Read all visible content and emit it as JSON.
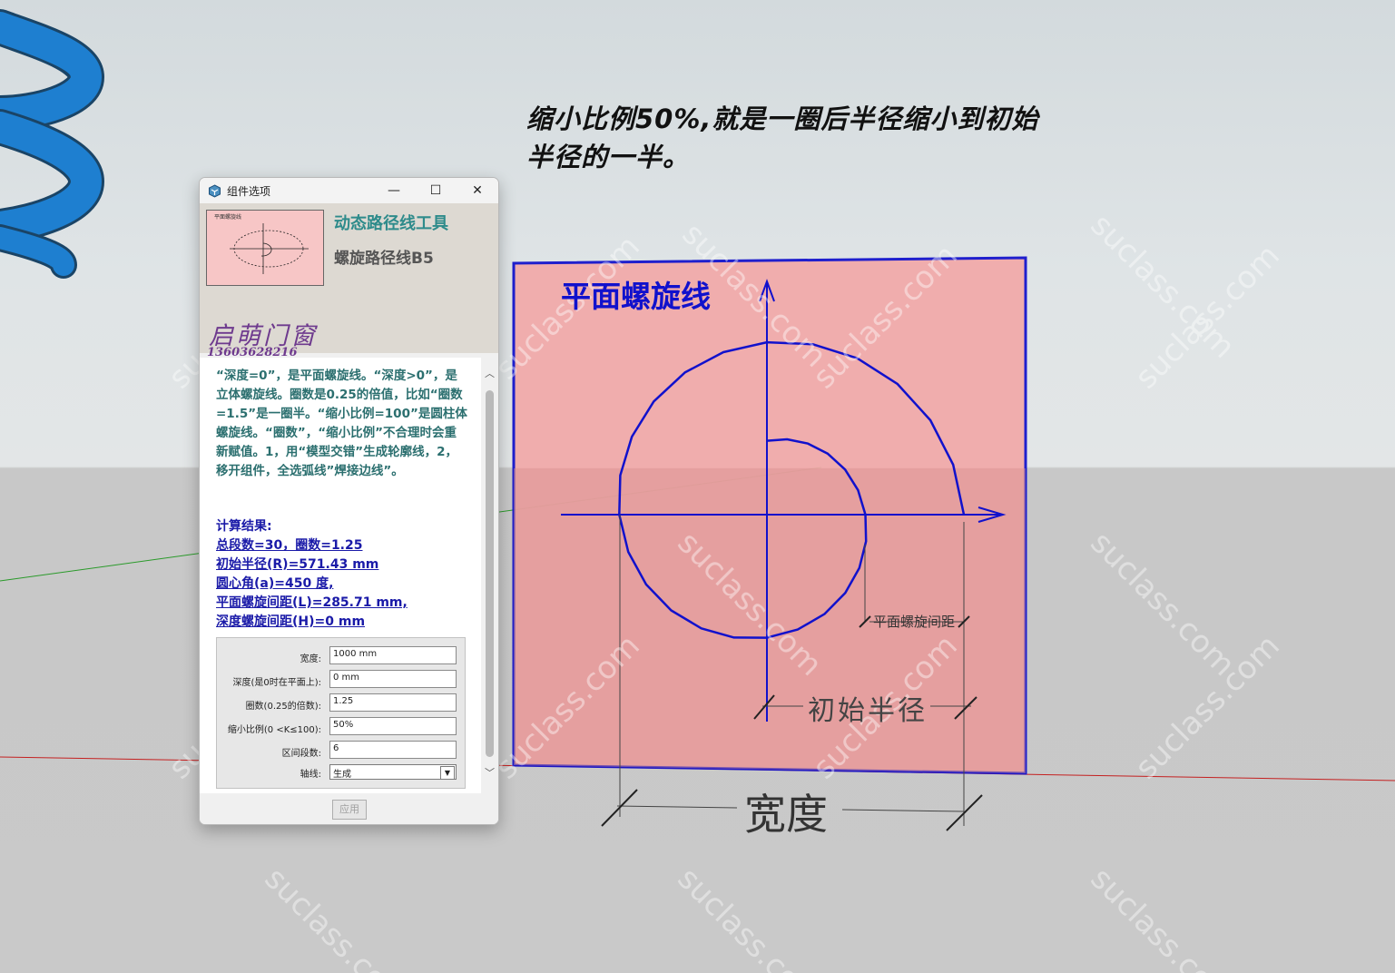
{
  "caption": "缩小比例50%,就是一圈后半径缩小到初始半径的一半。",
  "watermark": "suclass.com",
  "diagram": {
    "title": "平面螺旋线",
    "spacing_label": "平面螺旋间距",
    "radius_label": "初始半径",
    "width_label": "宽度"
  },
  "dialog": {
    "window_title": "组件选项",
    "minimize": "—",
    "maximize": "☐",
    "close": "✕",
    "thumbnail_label": "平面螺旋线",
    "tool_title": "动态路径线工具",
    "tool_subtitle": "螺旋路径线B5",
    "brand": "启萌门窗",
    "phone": "13603628216",
    "description": "“深度=0”，是平面螺旋线。“深度>0”，是立体螺旋线。圈数是0.25的倍值，比如“圈数=1.5”是一圈半。“缩小比例=100”是圆柱体螺旋线。“圈数”，“缩小比例”不合理时会重新赋值。1，用“模型交错”生成轮廓线，2，移开组件，全选弧线”焊接边线”。",
    "results": {
      "heading": "计算结果:",
      "lines": [
        "总段数=30，圈数=1.25",
        "初始半径(R)=571.43 mm",
        "圆心角(a)=450 度,",
        "平面螺旋间距(L)=285.71 mm,",
        "深度螺旋间距(H)=0 mm"
      ]
    },
    "fields": [
      {
        "label": "宽度:",
        "value": "1000 mm"
      },
      {
        "label": "深度(是0时在平面上):",
        "value": "0 mm"
      },
      {
        "label": "圈数(0.25的倍数):",
        "value": "1.25"
      },
      {
        "label": "缩小比例(0 <K≤100):",
        "value": "50%"
      },
      {
        "label": "区间段数:",
        "value": "6"
      }
    ],
    "axis": {
      "label": "轴线:",
      "value": "生成"
    },
    "apply_label": "应用"
  },
  "colors": {
    "accent_blue": "#1111cc",
    "panel_pink": "#f2a9a9",
    "title_teal": "#2e8b8b",
    "brand_purple": "#6e3a8e",
    "coil_blue": "#1e7fd0"
  }
}
